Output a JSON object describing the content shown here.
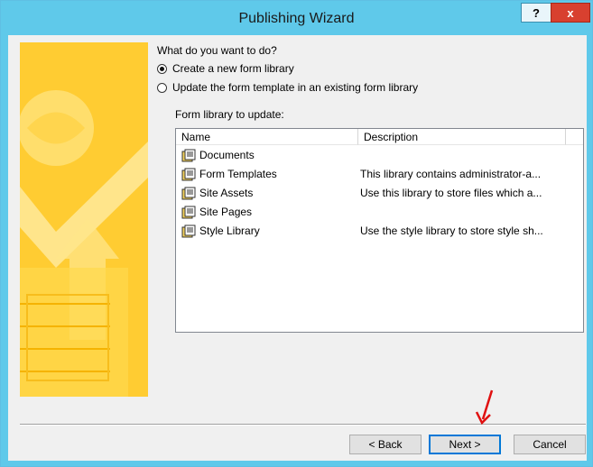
{
  "window": {
    "title": "Publishing Wizard",
    "help_label": "?",
    "close_label": "x"
  },
  "content": {
    "question": "What do you want to do?",
    "options": [
      {
        "label": "Create a new form library",
        "selected": true
      },
      {
        "label": "Update the form template in an existing form library",
        "selected": false
      }
    ],
    "list_label": "Form library to update:",
    "columns": [
      "Name",
      "Description"
    ],
    "libraries": [
      {
        "name": "Documents",
        "description": ""
      },
      {
        "name": "Form Templates",
        "description": "This library contains administrator-a..."
      },
      {
        "name": "Site Assets",
        "description": "Use this library to store files which a..."
      },
      {
        "name": "Site Pages",
        "description": ""
      },
      {
        "name": "Style Library",
        "description": "Use the style library to store style sh..."
      }
    ]
  },
  "buttons": {
    "back": "< Back",
    "next": "Next >",
    "cancel": "Cancel"
  },
  "colors": {
    "titlebar": "#5fc9ea",
    "close": "#d8402f",
    "annotation": "#e01010"
  }
}
